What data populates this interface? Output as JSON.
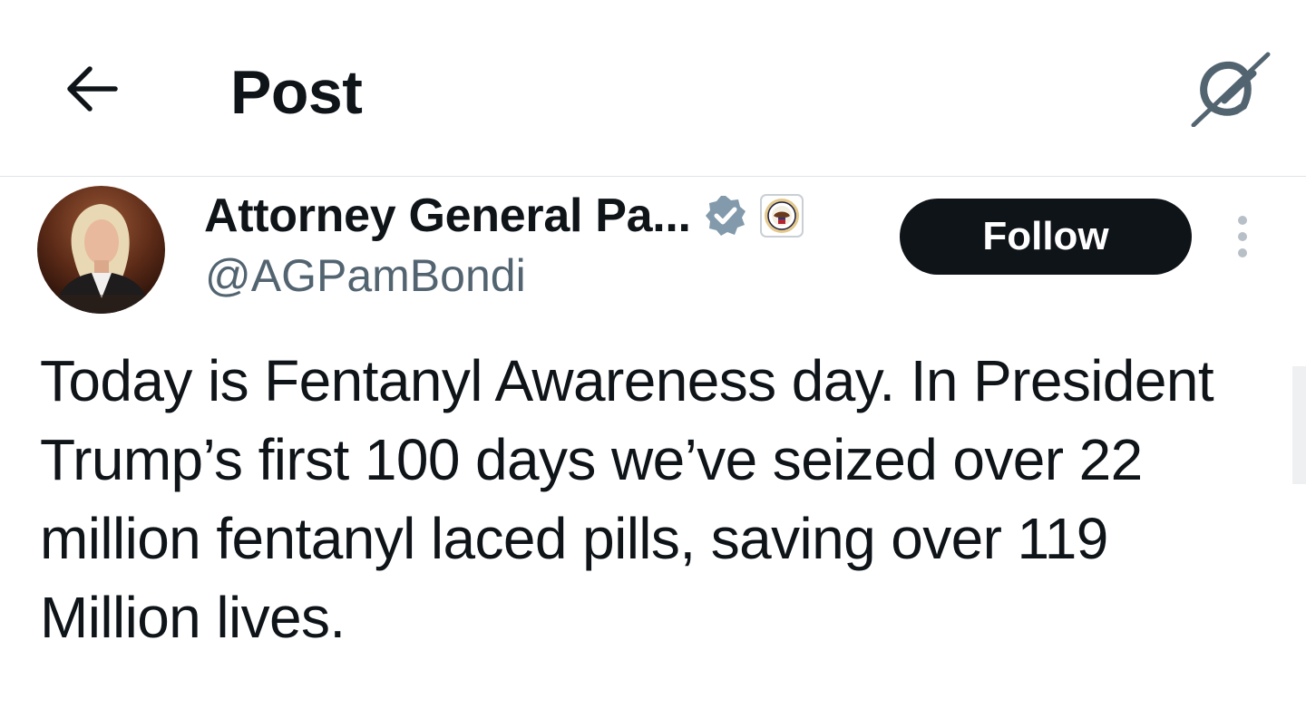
{
  "header": {
    "back_icon": "arrow-left-icon",
    "title": "Post",
    "grok_icon": "grok-icon"
  },
  "author": {
    "name": "Attorney General Pa...",
    "handle": "@AGPamBondi",
    "verified_icon": "verified-badge-icon",
    "affiliate_icon": "doj-seal-icon"
  },
  "actions": {
    "follow_label": "Follow",
    "more_icon": "more-vertical-icon"
  },
  "post": {
    "text": "Today is Fentanyl Awareness day. In President Trump’s first 100 days we’ve seized over 22 million fentanyl laced pills, saving over 119 Million lives."
  },
  "colors": {
    "text_primary": "#0f1419",
    "text_secondary": "#536471",
    "follow_bg": "#0f1419",
    "verified_badge": "#829aab",
    "divider": "#e1e5e8"
  }
}
